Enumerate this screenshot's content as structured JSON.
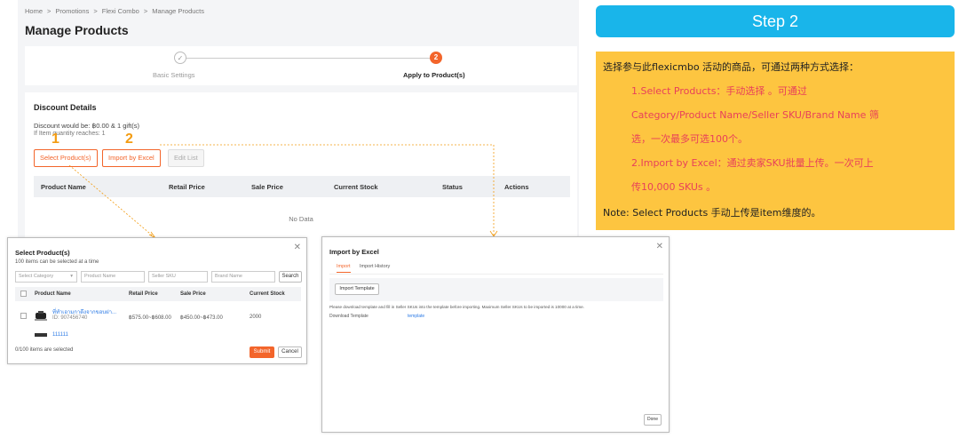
{
  "breadcrumb": {
    "items": [
      "Home",
      "Promotions",
      "Flexi Combo",
      "Manage Products"
    ],
    "sep": ">"
  },
  "page_title": "Manage Products",
  "steps": [
    {
      "label": "Basic Settings",
      "icon": "check-icon",
      "mark": "✓"
    },
    {
      "label": "Apply to Product(s)",
      "num": "2"
    }
  ],
  "discount": {
    "title": "Discount Details",
    "line1": "Discount would be: ฿0.00 & 1 gift(s)",
    "line2": "If Item quantity reaches: 1",
    "select_btn": "Select Product(s)",
    "import_btn": "Import by Excel",
    "edit_btn": "Edit List",
    "columns": [
      "Product Name",
      "Retail Price",
      "Sale Price",
      "Current Stock",
      "Status",
      "Actions"
    ],
    "empty": "No Data"
  },
  "markers": [
    "1",
    "2"
  ],
  "step_banner": "Step 2",
  "note": {
    "l1": "选择参与此flexicmbo 活动的商品，可通过两种方式选择：",
    "l2": "1.Select Products：手动选择 。可通过",
    "l3": "Category/Product Name/Seller SKU/Brand Name 筛",
    "l4": "选，一次最多可选100个。",
    "l5": "2.Import by Excel：通过卖家SKU批量上传。一次可上",
    "l6": "传10,000 SKUs 。",
    "l7": "Note: Select Products 手动上传是item维度的。"
  },
  "select_dialog": {
    "title": "Select Product(s)",
    "subtitle": "100 items can be selected at a time",
    "category_placeholder": "Select Category",
    "name_placeholder": "Product Name",
    "sku_placeholder": "Seller SKU",
    "brand_placeholder": "Brand Name",
    "search": "Search",
    "columns": [
      "Product Name",
      "Retail Price",
      "Sale Price",
      "Current Stock"
    ],
    "rows": [
      {
        "name": "ที่ทำเอามกาดึงจากขอบฝา...",
        "id": "ID: 907456740",
        "retail": "฿575.00~฿608.00",
        "sale": "฿450.00~฿473.00",
        "stock": "2000"
      },
      {
        "name": "111111"
      }
    ],
    "selected": "0/100  items are selected",
    "submit": "Submit",
    "cancel": "Cancel"
  },
  "import_dialog": {
    "title": "Import by Excel",
    "tabs": [
      "Import",
      "Import History"
    ],
    "template_btn": "Import Template",
    "info": "Please download template and fill in Seller SKUs into the template before importing. Maximum Seller SKUs to be imported is 10000 at a time.",
    "download_label": "Download Template",
    "download_link": "template",
    "done": "Done"
  },
  "colors": {
    "accent": "#f3652b",
    "banner": "#19b5ea",
    "note_bg": "#fdc540",
    "note_red": "#e8405a",
    "marker": "#f39c12"
  }
}
